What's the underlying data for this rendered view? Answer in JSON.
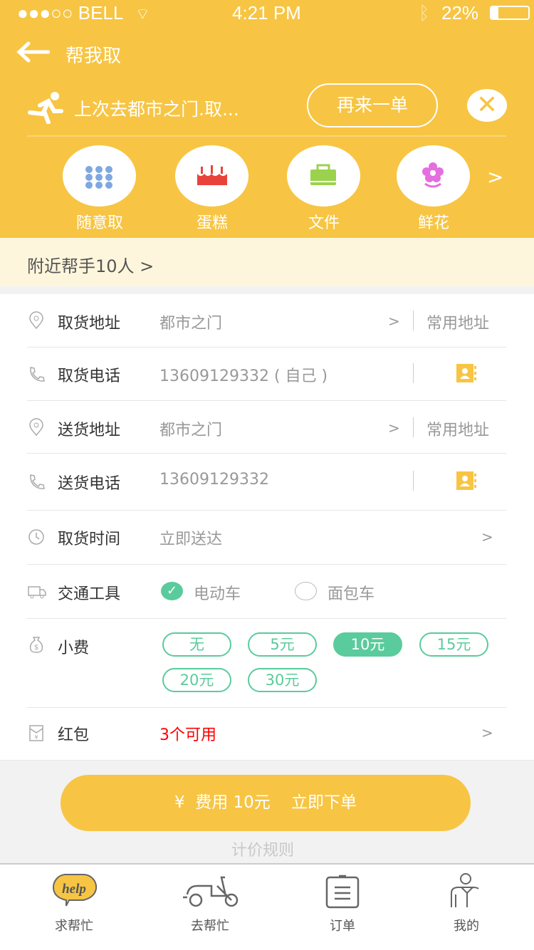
{
  "status_bar": {
    "carrier": "●●●○○ BELL",
    "time": "4:21 PM",
    "battery": "22%"
  },
  "header": {
    "title": "帮我取"
  },
  "last_order": {
    "text": "上次去都市之门.取...",
    "reorder_label": "再来一单"
  },
  "categories": [
    {
      "label": "随意取",
      "icon": "grid-icon"
    },
    {
      "label": "蛋糕",
      "icon": "cake-icon"
    },
    {
      "label": "文件",
      "icon": "bag-icon"
    },
    {
      "label": "鲜花",
      "icon": "flower-icon"
    }
  ],
  "categories_more": ">",
  "nearby": {
    "text": "附近帮手10人 >"
  },
  "form": {
    "pickup_address": {
      "label": "取货地址",
      "value": "都市之门",
      "chevron": ">",
      "common": "常用地址"
    },
    "pickup_phone": {
      "label": "取货电话",
      "value": "13609129332 ( 自己 )"
    },
    "delivery_address": {
      "label": "送货地址",
      "value": "都市之门",
      "chevron": ">",
      "common": "常用地址"
    },
    "delivery_phone": {
      "label": "送货电话",
      "value": "13609129332"
    },
    "pickup_time": {
      "label": "取货时间",
      "value": "立即送达",
      "chevron": ">"
    },
    "vehicle": {
      "label": "交通工具",
      "options": [
        {
          "label": "电动车",
          "selected": true
        },
        {
          "label": "面包车",
          "selected": false
        }
      ]
    },
    "tip": {
      "label": "小费",
      "options": [
        "无",
        "5元",
        "10元",
        "15元",
        "20元",
        "30元"
      ],
      "selected": "10元"
    },
    "red_packet": {
      "label": "红包",
      "value": "3个可用",
      "chevron": ">"
    }
  },
  "submit": {
    "label": "¥  费用 10元    立即下单"
  },
  "pricing_rules": "计价规则",
  "tabs": [
    {
      "label": "求帮忙",
      "active": true
    },
    {
      "label": "去帮忙"
    },
    {
      "label": "订单"
    },
    {
      "label": "我的"
    }
  ],
  "colors": {
    "brand": "#F7C543",
    "accent": "#5ACB9C",
    "red": "#FF0000"
  }
}
